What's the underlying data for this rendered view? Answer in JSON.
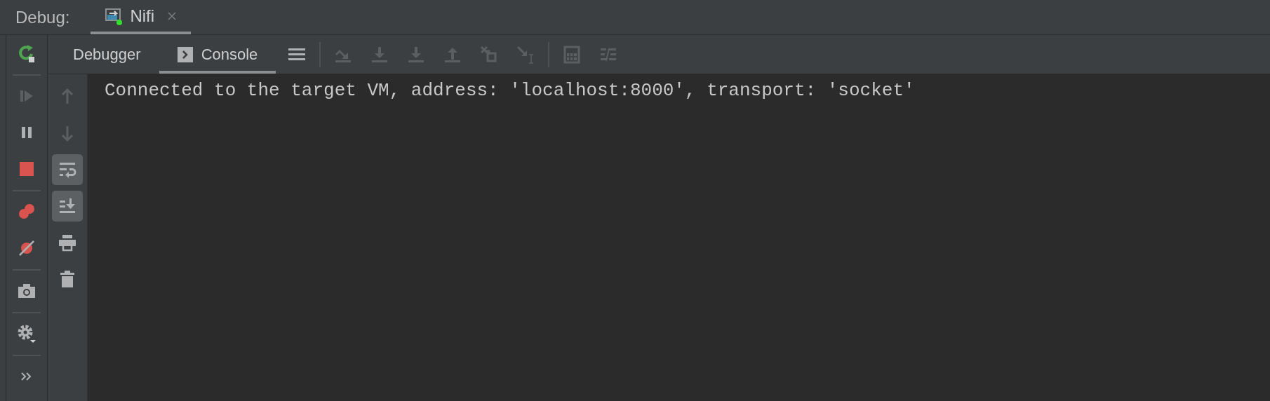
{
  "header": {
    "label": "Debug:",
    "tabs": [
      {
        "label": "Nifi",
        "selected": true
      }
    ]
  },
  "left_toolbar": [
    [
      {
        "kind": "rerun",
        "disabled": false
      }
    ],
    [
      {
        "kind": "resume",
        "disabled": true
      },
      {
        "kind": "pause",
        "disabled": false
      },
      {
        "kind": "stop",
        "disabled": false
      }
    ],
    [
      {
        "kind": "breakpoints",
        "disabled": false
      },
      {
        "kind": "mute",
        "disabled": false
      }
    ],
    [
      {
        "kind": "camera",
        "disabled": false
      }
    ],
    [
      {
        "kind": "settings",
        "disabled": false
      }
    ],
    [
      {
        "kind": "more",
        "disabled": false
      }
    ]
  ],
  "tabs": [
    {
      "label": "Debugger",
      "selected": false,
      "kind": "plain"
    },
    {
      "label": "Console",
      "selected": true,
      "kind": "console"
    }
  ],
  "toolbar": [
    [
      {
        "kind": "layout",
        "disabled": false
      }
    ],
    [
      {
        "kind": "step-over",
        "disabled": true
      },
      {
        "kind": "step-into",
        "disabled": true
      },
      {
        "kind": "force-step-into",
        "disabled": true
      },
      {
        "kind": "step-out",
        "disabled": true
      },
      {
        "kind": "drop-frame",
        "disabled": true
      },
      {
        "kind": "run-to-cursor",
        "disabled": true
      }
    ],
    [
      {
        "kind": "evaluate",
        "disabled": true
      },
      {
        "kind": "trace",
        "disabled": true
      }
    ]
  ],
  "console_toolbar": [
    {
      "kind": "up",
      "disabled": true,
      "on": false
    },
    {
      "kind": "down",
      "disabled": true,
      "on": false
    },
    {
      "kind": "wrap",
      "disabled": false,
      "on": true
    },
    {
      "kind": "scroll-end",
      "disabled": false,
      "on": true
    },
    {
      "kind": "print",
      "disabled": false,
      "on": false
    },
    {
      "kind": "trash",
      "disabled": false,
      "on": false
    }
  ],
  "console": {
    "lines": [
      "Connected to the target VM, address: 'localhost:8000', transport: 'socket'"
    ]
  }
}
